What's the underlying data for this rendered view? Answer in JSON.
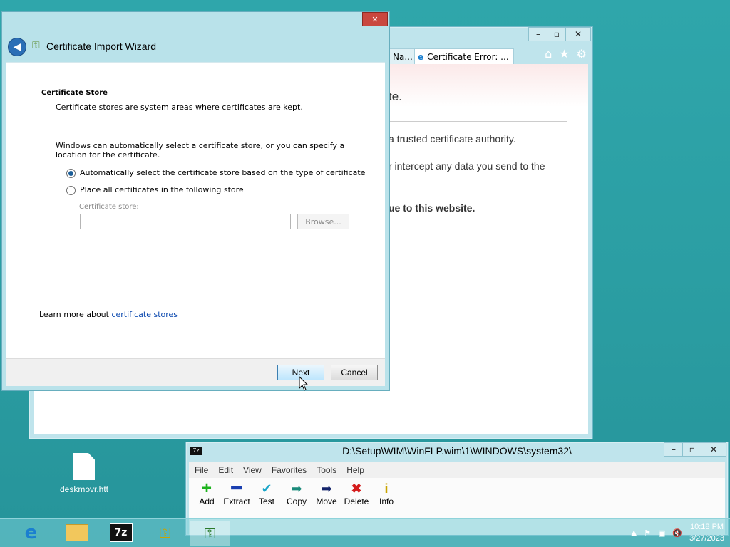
{
  "ie": {
    "tabs": [
      {
        "label": "Na..."
      },
      {
        "label": "Certificate Error: ..."
      }
    ],
    "body_lines": [
      "te.",
      "a trusted certificate authority.",
      "r intercept any data you send to the",
      "ue to this website."
    ]
  },
  "wizard": {
    "title": "Certificate Import Wizard",
    "section_title": "Certificate Store",
    "section_desc": "Certificate stores are system areas where certificates are kept.",
    "intro": "Windows can automatically select a certificate store, or you can specify a location for the certificate.",
    "radio_auto": "Automatically select the certificate store based on the type of certificate",
    "radio_manual": "Place all certificates in the following store",
    "store_label": "Certificate store:",
    "store_value": "",
    "browse": "Browse...",
    "learn_prefix": "Learn more about",
    "learn_link": "certificate stores",
    "next": "Next",
    "cancel": "Cancel",
    "selected": "auto"
  },
  "sevenzip": {
    "title": "D:\\Setup\\WIM\\WinFLP.wim\\1\\WINDOWS\\system32\\",
    "menu": [
      "File",
      "Edit",
      "View",
      "Favorites",
      "Tools",
      "Help"
    ],
    "tools": [
      {
        "label": "Add",
        "icon": "plus-icon"
      },
      {
        "label": "Extract",
        "icon": "minus-icon"
      },
      {
        "label": "Test",
        "icon": "check-icon"
      },
      {
        "label": "Copy",
        "icon": "copy-arrow-icon"
      },
      {
        "label": "Move",
        "icon": "move-arrow-icon"
      },
      {
        "label": "Delete",
        "icon": "delete-x-icon"
      },
      {
        "label": "Info",
        "icon": "info-icon"
      }
    ]
  },
  "desktop": {
    "icon_label": "deskmovr.htt"
  },
  "taskbar": {
    "time": "10:18 PM",
    "date": "3/27/2023"
  }
}
